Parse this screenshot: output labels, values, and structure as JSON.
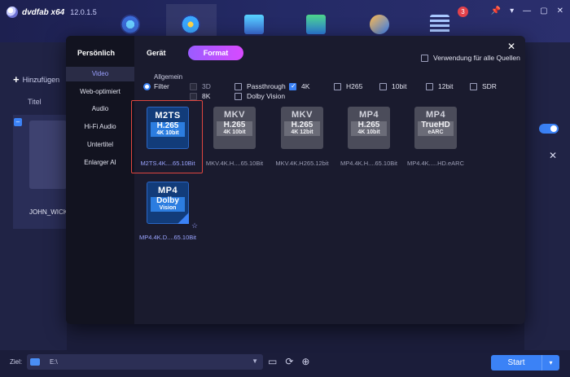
{
  "app": {
    "name": "dvdfab x64",
    "version": "12.0.1.5",
    "notification_count": "3"
  },
  "toolbar_right": {
    "pin": "📌",
    "menu": "▾",
    "min": "—",
    "max": "▢",
    "close": "✕"
  },
  "left": {
    "add_label": "Hinzufügen",
    "title_col": "Titel",
    "item_name": "JOHN_WICK"
  },
  "bottom": {
    "ziel_label": "Ziel:",
    "ziel_value": "E:\\",
    "start_label": "Start"
  },
  "modal": {
    "sidebar_head": "Persönlich",
    "sidebar_items": [
      "Video",
      "Web-optimiert",
      "Audio",
      "Hi-Fi Audio",
      "Untertitel",
      "Enlarger AI"
    ],
    "tab_device": "Gerät",
    "tab_format": "Format",
    "apply_all": "Verwendung für alle Quellen",
    "section": "Allgemein",
    "filter": "Filter",
    "options": {
      "3d": "3D",
      "8k": "8K",
      "passthrough": "Passthrough",
      "dolby": "Dolby Vision",
      "4k": "4K",
      "h265": "H265",
      "10bit": "10bit",
      "12bit": "12bit",
      "sdr": "SDR"
    },
    "formats": [
      {
        "t1": "M2TS",
        "t2": "H.265",
        "t3": "4K 10bit",
        "label": "M2TS.4K....65.10Bit"
      },
      {
        "t1": "MKV",
        "t2": "H.265",
        "t3": "4K 10bit",
        "label": "MKV.4K.H....65.10Bit"
      },
      {
        "t1": "MKV",
        "t2": "H.265",
        "t3": "4K 12bit",
        "label": "MKV.4K.H265.12bit"
      },
      {
        "t1": "MP4",
        "t2": "H.265",
        "t3": "4K 10bit",
        "label": "MP4.4K.H....65.10Bit"
      },
      {
        "t1": "MP4",
        "t2": "TrueHD",
        "t3": "eARC",
        "label": "MP4.4K.....HD.eARC"
      },
      {
        "t1": "MP4",
        "t2": "Dolby",
        "t3": "Vision",
        "label": "MP4.4K.D....65.10Bit"
      }
    ]
  },
  "colors": {
    "accent": "#3b82f6",
    "format_tab_gradient": "#9b5cff",
    "selection": "#e0463f"
  }
}
